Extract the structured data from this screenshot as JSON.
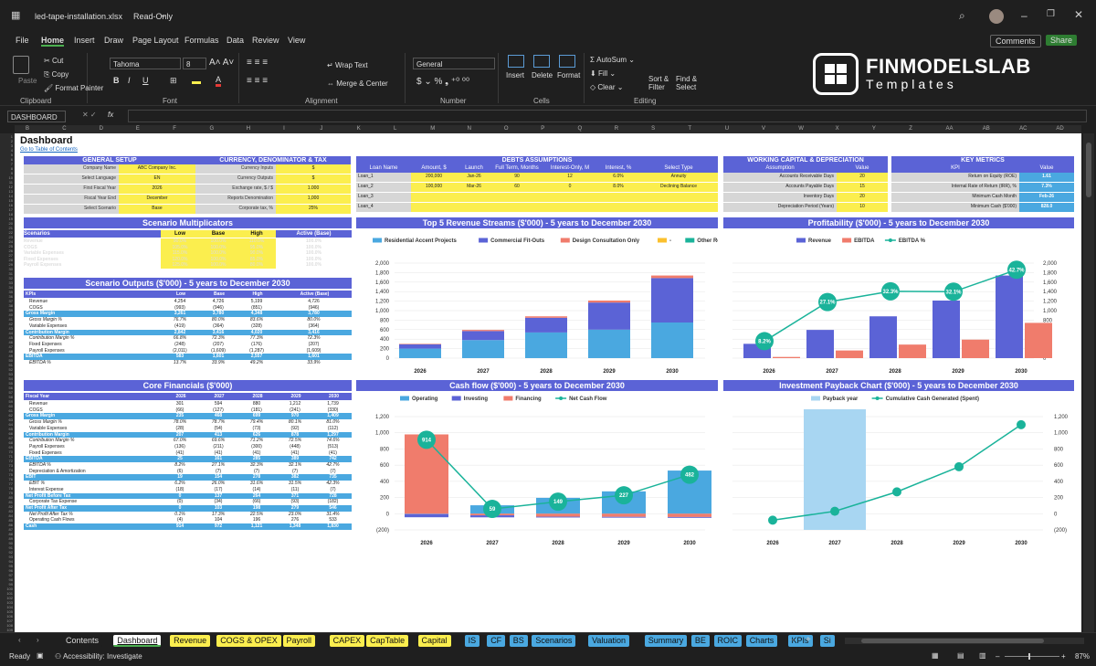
{
  "window": {
    "title": "led-tape-installation.xlsx",
    "mode": "Read-Only"
  },
  "menu": [
    "File",
    "Home",
    "Insert",
    "Draw",
    "Page Layout",
    "Formulas",
    "Data",
    "Review",
    "View"
  ],
  "actions": {
    "comments": "Comments",
    "share": "Share"
  },
  "ribbon": {
    "paste": "Paste",
    "cut": "Cut",
    "copy": "Copy",
    "format_painter": "Format Painter",
    "clipboard": "Clipboard",
    "font_name": "Tahoma",
    "font_size": "8",
    "font": "Font",
    "wrap": "Wrap Text",
    "merge": "Merge & Center",
    "alignment": "Alignment",
    "numfmt": "General",
    "number": "Number",
    "insert": "Insert",
    "delete": "Delete",
    "format": "Format",
    "cells": "Cells",
    "autosum": "AutoSum",
    "fill": "Fill",
    "clear": "Clear",
    "sort": "Sort & Filter",
    "find": "Find & Select",
    "editing": "Editing",
    "brand": "FINMODELSLAB",
    "brand_sub": "Templates"
  },
  "formula": {
    "namebox": "DASHBOARD",
    "fx": "fx"
  },
  "columns": [
    "B",
    "C",
    "D",
    "E",
    "F",
    "G",
    "H",
    "I",
    "J",
    "K",
    "L",
    "M",
    "N",
    "O",
    "P",
    "Q",
    "R",
    "S",
    "T",
    "U",
    "V",
    "W",
    "X",
    "Y",
    "Z",
    "AA",
    "AB",
    "AC",
    "AD"
  ],
  "rows": [
    "1",
    "2",
    "3",
    "4",
    "5",
    "6",
    "7",
    "8",
    "9",
    "10",
    "11",
    "12",
    "13",
    "14",
    "15",
    "16",
    "17",
    "18",
    "19",
    "20",
    "21",
    "22",
    "23",
    "24",
    "25",
    "26",
    "27",
    "28",
    "29",
    "30",
    "31",
    "32",
    "33",
    "34",
    "35",
    "36",
    "37",
    "38",
    "39",
    "40",
    "41",
    "42",
    "43",
    "44",
    "45",
    "46",
    "47",
    "48",
    "49",
    "50",
    "51",
    "52",
    "53",
    "54",
    "55",
    "56",
    "57",
    "58",
    "59",
    "60",
    "61",
    "62",
    "63",
    "64",
    "65",
    "66",
    "67",
    "68",
    "69",
    "70",
    "71",
    "72",
    "73",
    "74",
    "75",
    "76",
    "77",
    "78",
    "79",
    "80",
    "81",
    "82",
    "83",
    "84",
    "85",
    "86",
    "87",
    "88",
    "89",
    "90",
    "91",
    "92",
    "93",
    "94",
    "95",
    "96",
    "97",
    "98",
    "99",
    "100",
    "101",
    "102",
    "103",
    "104",
    "105",
    "106",
    "107",
    "108",
    "109"
  ],
  "sheet": {
    "title": "Dashboard",
    "toc": "Go to Table of Contents",
    "general": {
      "title": "GENERAL SETUP",
      "rows": [
        [
          "Company Name",
          "ABC Company Inc."
        ],
        [
          "Select Language",
          "EN"
        ],
        [
          "First Fiscal Year",
          "2026"
        ],
        [
          "Fiscal Year End",
          "December"
        ],
        [
          "Select Scenario",
          "Base"
        ]
      ]
    },
    "currency": {
      "title": "CURRENCY, DENOMINATOR & TAX",
      "rows": [
        [
          "Currency Inputs",
          "$"
        ],
        [
          "Currency Outputs",
          "$"
        ],
        [
          "Exchange rate, $ / $",
          "1.000"
        ],
        [
          "Reports Denomination",
          "1,000"
        ],
        [
          "Corporate tax, %",
          "25%"
        ]
      ]
    },
    "debts": {
      "title": "DEBTS ASSUMPTIONS",
      "headers": [
        "Loan Name",
        "Amount, $",
        "Launch",
        "Full Term, Months",
        "Interest-Only, M",
        "Interest, %",
        "Select Type"
      ],
      "rows": [
        [
          "Loan_1",
          "200,000",
          "Jan-26",
          "90",
          "12",
          "6.0%",
          "Annuity"
        ],
        [
          "Loan_2",
          "100,000",
          "Mar-26",
          "60",
          "0",
          "8.0%",
          "Declining Balance"
        ],
        [
          "Loan_3",
          "",
          "",
          "",
          "",
          "",
          ""
        ],
        [
          "Loan_4",
          "",
          "",
          "",
          "",
          "",
          ""
        ]
      ]
    },
    "wc": {
      "title": "WORKING CAPITAL & DEPRECIATION",
      "headers": [
        "Assumption",
        "Value"
      ],
      "rows": [
        [
          "Accounts Receivable Days",
          "20"
        ],
        [
          "Accounts Payable Days",
          "15"
        ],
        [
          "Inventory Days",
          "20"
        ],
        [
          "Depreciation Period (Years)",
          "10"
        ]
      ]
    },
    "kpi": {
      "title": "KEY METRICS",
      "headers": [
        "KPI",
        "Value"
      ],
      "rows": [
        [
          "Return on Equity (ROE)",
          "1.61"
        ],
        [
          "Internal Rate of Return (IRR), %",
          "7.3%"
        ],
        [
          "Minimum Cash Month",
          "Feb-26"
        ],
        [
          "Minimum Cash ($'000)",
          "828.0"
        ]
      ]
    },
    "scen": {
      "title": "Scenario Multiplicators",
      "headers": [
        "Scenarios",
        "Low",
        "Base",
        "High",
        "Active (Base)"
      ],
      "rows": [
        [
          "Revenue",
          "90.0%",
          "100.0%",
          "110.0%",
          "100.0%"
        ],
        [
          "COGS",
          "105.0%",
          "100.0%",
          "95.0%",
          "100.0%"
        ],
        [
          "Variable Expenses",
          "115.0%",
          "100.0%",
          "90.0%",
          "100.0%"
        ],
        [
          "Fixed Expenses",
          "120.0%",
          "100.0%",
          "85.0%",
          "100.0%"
        ],
        [
          "Payroll Expenses",
          "125.0%",
          "100.0%",
          "80.0%",
          "100.0%"
        ]
      ]
    },
    "scenout": {
      "title": "Scenario Outputs ($'000) - 5 years to December 2030",
      "headers": [
        "KPIs",
        "Low",
        "Base",
        "High",
        "Active (Base)"
      ],
      "rows": [
        [
          "Revenue",
          "4,254",
          "4,726",
          "5,199",
          "4,726",
          0
        ],
        [
          "COGS",
          "(993)",
          "(946)",
          "(851)",
          "(946)",
          0
        ],
        [
          "Gross Margin",
          "3,261",
          "3,780",
          "4,348",
          "3,780",
          1
        ],
        [
          "Gross Margin %",
          "76.7%",
          "80.0%",
          "83.6%",
          "80.0%",
          2
        ],
        [
          "Variable Expenses",
          "(419)",
          "(364)",
          "(328)",
          "(364)",
          0
        ],
        [
          "Contribution Margin",
          "2,842",
          "3,416",
          "4,020",
          "3,416",
          1
        ],
        [
          "Contribution Margin %",
          "66.8%",
          "72.3%",
          "77.3%",
          "72.3%",
          2
        ],
        [
          "Fixed Expenses",
          "(248)",
          "(207)",
          "(176)",
          "(207)",
          0
        ],
        [
          "Payroll Expenses",
          "(2,011)",
          "(1,609)",
          "(1,287)",
          "(1,609)",
          0
        ],
        [
          "EBITDA",
          "583",
          "1,601",
          "2,557",
          "1,601",
          1
        ],
        [
          "EBITDA %",
          "13.7%",
          "33.9%",
          "49.2%",
          "33.9%",
          2
        ]
      ]
    },
    "core": {
      "title": "Core Financials ($'000)",
      "headers": [
        "Fiscal Year",
        "2026",
        "2027",
        "2028",
        "2029",
        "2030"
      ],
      "rows": [
        [
          "Revenue",
          "301",
          "594",
          "880",
          "1,212",
          "1,739",
          0
        ],
        [
          "COGS",
          "(66)",
          "(127)",
          "(181)",
          "(241)",
          "(330)",
          0
        ],
        [
          "Gross Margin",
          "235",
          "468",
          "699",
          "970",
          "1,409",
          1
        ],
        [
          "Gross Margin %",
          "78.0%",
          "78.7%",
          "79.4%",
          "80.1%",
          "81.0%",
          2
        ],
        [
          "Variable Expenses",
          "(28)",
          "(54)",
          "(73)",
          "(92)",
          "(112)",
          0
        ],
        [
          "Contribution Margin",
          "207",
          "413",
          "626",
          "878",
          "1,297",
          1
        ],
        [
          "Contribution Margin %",
          "67.0%",
          "69.6%",
          "71.2%",
          "72.5%",
          "74.6%",
          2
        ],
        [
          "Payroll Expenses",
          "(136)",
          "(211)",
          "(300)",
          "(448)",
          "(513)",
          0
        ],
        [
          "Fixed Expenses",
          "(41)",
          "(41)",
          "(41)",
          "(41)",
          "(41)",
          0
        ],
        [
          "EBITDA",
          "25",
          "161",
          "285",
          "389",
          "742",
          1
        ],
        [
          "EBITDA %",
          "8.2%",
          "27.1%",
          "32.3%",
          "32.1%",
          "42.7%",
          2
        ],
        [
          "Depreciation & Amortization",
          "(6)",
          "(7)",
          "(7)",
          "(7)",
          "(7)",
          0
        ],
        [
          "EBIT",
          "19",
          "154",
          "278",
          "382",
          "735",
          1
        ],
        [
          "EBIT %",
          "6.2%",
          "26.0%",
          "31.6%",
          "31.5%",
          "42.3%",
          2
        ],
        [
          "Interest Expense",
          "(18)",
          "(17)",
          "(14)",
          "(11)",
          "(7)",
          0
        ],
        [
          "Net Profit Before Tax",
          "0",
          "137",
          "264",
          "371",
          "728",
          1
        ],
        [
          "Corporate Tax Expense",
          "(0)",
          "(34)",
          "(66)",
          "(93)",
          "(182)",
          0
        ],
        [
          "Net Profit After Tax",
          "0",
          "103",
          "198",
          "279",
          "546",
          1
        ],
        [
          "Net Profit After Tax %",
          "0.1%",
          "17.3%",
          "22.5%",
          "23.0%",
          "31.4%",
          2
        ],
        [
          "Operating Cash Flows",
          "(4)",
          "104",
          "196",
          "276",
          "533",
          0
        ],
        [
          "Cash",
          "914",
          "972",
          "1,121",
          "1,348",
          "1,830",
          1
        ]
      ]
    }
  },
  "charts": {
    "revenue": {
      "title": "Top 5 Revenue Streams ($'000) - 5 years to December 2030",
      "legend": [
        "Residential Accent Projects",
        "Commercial Fit-Outs",
        "Design Consultation Only",
        "-",
        "Other Revenue"
      ]
    },
    "profit": {
      "title": "Profitability ($'000) - 5 years to December 2030",
      "legend": [
        "Revenue",
        "EBITDA",
        "EBITDA %"
      ]
    },
    "cash": {
      "title": "Cash flow ($'000) - 5 years to December 2030",
      "legend": [
        "Operating",
        "Investing",
        "Financing",
        "Net Cash Flow"
      ]
    },
    "payback": {
      "title": "Investment Payback Chart ($'000) - 5 years to December 2030",
      "legend": [
        "Payback year",
        "Cumulative Cash Generated (Spent)"
      ]
    }
  },
  "chart_data": [
    {
      "type": "bar",
      "title": "Top 5 Revenue Streams ($'000) - 5 years to December 2030",
      "categories": [
        "2026",
        "2027",
        "2028",
        "2029",
        "2030"
      ],
      "ylim": [
        0,
        2000
      ],
      "series": [
        {
          "name": "Residential Accent Projects",
          "values": [
            200,
            380,
            540,
            600,
            750
          ]
        },
        {
          "name": "Commercial Fit-Outs",
          "values": [
            90,
            190,
            310,
            570,
            935
          ]
        },
        {
          "name": "Design Consultation Only",
          "values": [
            11,
            24,
            30,
            42,
            54
          ]
        }
      ]
    },
    {
      "type": "bar",
      "title": "Profitability ($'000) - 5 years to December 2030",
      "categories": [
        "2026",
        "2027",
        "2028",
        "2029",
        "2030"
      ],
      "ylim": [
        0,
        2000
      ],
      "series": [
        {
          "name": "Revenue",
          "values": [
            301,
            594,
            880,
            1212,
            1739
          ]
        },
        {
          "name": "EBITDA",
          "values": [
            25,
            161,
            285,
            389,
            742
          ]
        },
        {
          "name": "EBITDA %",
          "values": [
            8.2,
            27.1,
            32.3,
            32.1,
            42.7
          ]
        }
      ]
    },
    {
      "type": "bar",
      "title": "Cash flow ($'000) - 5 years to December 2030",
      "categories": [
        "2026",
        "2027",
        "2028",
        "2029",
        "2030"
      ],
      "ylim": [
        -200,
        1200
      ],
      "series": [
        {
          "name": "Operating",
          "values": [
            -4,
            104,
            196,
            276,
            533
          ]
        },
        {
          "name": "Investing",
          "values": [
            -40,
            -25,
            -10,
            -10,
            -10
          ]
        },
        {
          "name": "Financing",
          "values": [
            980,
            -20,
            -37,
            -39,
            -41
          ]
        },
        {
          "name": "Net Cash Flow",
          "values": [
            914,
            59,
            149,
            227,
            482
          ]
        }
      ]
    },
    {
      "type": "line",
      "title": "Investment Payback Chart ($'000) - 5 years to December 2030",
      "categories": [
        "2026",
        "2027",
        "2028",
        "2029",
        "2030"
      ],
      "ylim": [
        -200,
        1200
      ],
      "series": [
        {
          "name": "Cumulative Cash Generated (Spent)",
          "values": [
            -80,
            30,
            270,
            580,
            1100
          ]
        },
        {
          "name": "Payback year",
          "values": [
            0,
            1,
            0,
            0,
            0
          ]
        }
      ]
    }
  ],
  "tabs": [
    {
      "label": "Contents",
      "color": "#1f1f1f",
      "fg": "#ddd"
    },
    {
      "label": "Dashboard",
      "color": "#fff",
      "fg": "#111"
    },
    {
      "label": "Revenue",
      "color": "#fbee4e"
    },
    {
      "label": "COGS & OPEX",
      "color": "#fbee4e"
    },
    {
      "label": "Payroll",
      "color": "#fbee4e"
    },
    {
      "label": "CAPEX",
      "color": "#fbee4e"
    },
    {
      "label": "CapTable",
      "color": "#fbee4e"
    },
    {
      "label": "Capital",
      "color": "#fbee4e"
    },
    {
      "label": "IS",
      "color": "#4aa8e0"
    },
    {
      "label": "CF",
      "color": "#4aa8e0"
    },
    {
      "label": "BS",
      "color": "#4aa8e0"
    },
    {
      "label": "Scenarios",
      "color": "#4aa8e0"
    },
    {
      "label": "Valuation",
      "color": "#4aa8e0"
    },
    {
      "label": "Summary",
      "color": "#4aa8e0"
    },
    {
      "label": "BE",
      "color": "#4aa8e0"
    },
    {
      "label": "ROIC",
      "color": "#4aa8e0"
    },
    {
      "label": "Charts",
      "color": "#4aa8e0"
    },
    {
      "label": "KPIs",
      "color": "#4aa8e0"
    },
    {
      "label": "Si",
      "color": "#4aa8e0"
    }
  ],
  "statusbar": {
    "ready": "Ready",
    "accessibility": "Accessibility: Investigate",
    "zoom": "87%"
  },
  "colors": {
    "accent": "#5b63d6",
    "teal": "#1ab39a",
    "blue": "#4aa8e0",
    "salmon": "#f07c6c",
    "yellow": "#fbee4e"
  }
}
